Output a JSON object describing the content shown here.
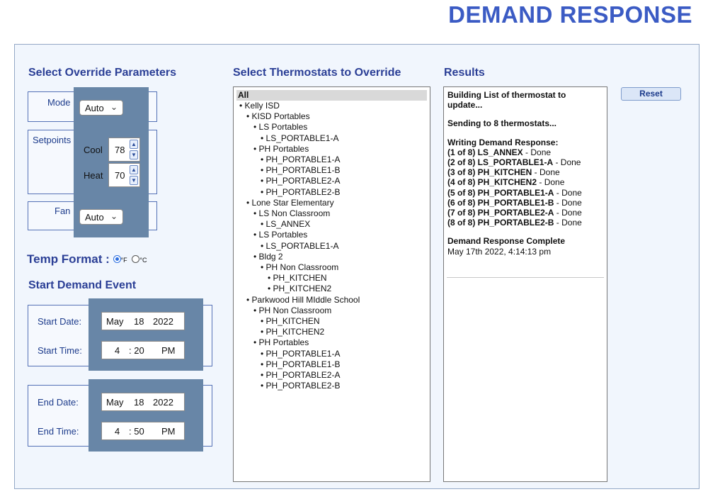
{
  "page_title": "DEMAND RESPONSE",
  "override": {
    "title": "Select Override Parameters",
    "mode_label": "Mode",
    "mode_value": "Auto",
    "setpoints_label": "Setpoints",
    "cool_label": "Cool",
    "cool_value": "78",
    "heat_label": "Heat",
    "heat_value": "70",
    "fan_label": "Fan",
    "fan_value": "Auto"
  },
  "temp_format": {
    "label": "Temp Format :",
    "options": [
      "°F",
      "°C"
    ],
    "selected": "°F"
  },
  "demand_event": {
    "title": "Start Demand Event",
    "start_date_label": "Start Date:",
    "start_date": {
      "month": "May",
      "day": "18",
      "year": "2022"
    },
    "start_time_label": "Start Time:",
    "start_time": {
      "hour": "4",
      "minute": ": 20",
      "ampm": "PM"
    },
    "end_date_label": "End Date:",
    "end_date": {
      "month": "May",
      "day": "18",
      "year": "2022"
    },
    "end_time_label": "End Time:",
    "end_time": {
      "hour": "4",
      "minute": ": 50",
      "ampm": "PM"
    }
  },
  "thermostats": {
    "title": "Select Thermostats to Override",
    "all_label": "All",
    "items": [
      {
        "text": "Kelly ISD",
        "level": 1
      },
      {
        "text": "KISD Portables",
        "level": 2
      },
      {
        "text": "LS Portables",
        "level": 3
      },
      {
        "text": "LS_PORTABLE1-A",
        "level": 4
      },
      {
        "text": "PH Portables",
        "level": 3
      },
      {
        "text": "PH_PORTABLE1-A",
        "level": 4
      },
      {
        "text": "PH_PORTABLE1-B",
        "level": 4
      },
      {
        "text": "PH_PORTABLE2-A",
        "level": 4
      },
      {
        "text": "PH_PORTABLE2-B",
        "level": 4
      },
      {
        "text": "Lone Star Elementary",
        "level": 2
      },
      {
        "text": "LS Non Classroom",
        "level": 3
      },
      {
        "text": "LS_ANNEX",
        "level": 4
      },
      {
        "text": "LS Portables",
        "level": 3
      },
      {
        "text": "LS_PORTABLE1-A",
        "level": 4
      },
      {
        "text": "Bldg 2",
        "level": 3
      },
      {
        "text": "PH Non Classroom",
        "level": 4
      },
      {
        "text": "PH_KITCHEN",
        "level": 5
      },
      {
        "text": "PH_KITCHEN2",
        "level": 5
      },
      {
        "text": "Parkwood Hill MIddle School",
        "level": 2
      },
      {
        "text": "PH Non Classroom",
        "level": 3
      },
      {
        "text": "PH_KITCHEN",
        "level": 4
      },
      {
        "text": "PH_KITCHEN2",
        "level": 4
      },
      {
        "text": "PH Portables",
        "level": 3
      },
      {
        "text": "PH_PORTABLE1-A",
        "level": 4
      },
      {
        "text": "PH_PORTABLE1-B",
        "level": 4
      },
      {
        "text": "PH_PORTABLE2-A",
        "level": 4
      },
      {
        "text": "PH_PORTABLE2-B",
        "level": 4
      }
    ]
  },
  "results": {
    "title": "Results",
    "reset_label": "Reset",
    "building_line1": "Building List of thermostat to",
    "building_line2": "update...",
    "sending": "Sending to 8 thermostats...",
    "writing": "Writing Demand Response:",
    "entries": [
      {
        "prefix": "(1 of 8) LS_ANNEX",
        "status": " - Done"
      },
      {
        "prefix": "(2 of 8) LS_PORTABLE1-A",
        "status": " - Done"
      },
      {
        "prefix": "(3 of 8) PH_KITCHEN",
        "status": " - Done"
      },
      {
        "prefix": "(4 of 8) PH_KITCHEN2",
        "status": " - Done"
      },
      {
        "prefix": "(5 of 8) PH_PORTABLE1-A",
        "status": " - Done"
      },
      {
        "prefix": "(6 of 8) PH_PORTABLE1-B",
        "status": " - Done"
      },
      {
        "prefix": "(7 of 8) PH_PORTABLE2-A",
        "status": " - Done"
      },
      {
        "prefix": "(8 of 8) PH_PORTABLE2-B",
        "status": " - Done"
      }
    ],
    "complete": "Demand Response Complete",
    "timestamp": "May 17th 2022, 4:14:13 pm"
  }
}
